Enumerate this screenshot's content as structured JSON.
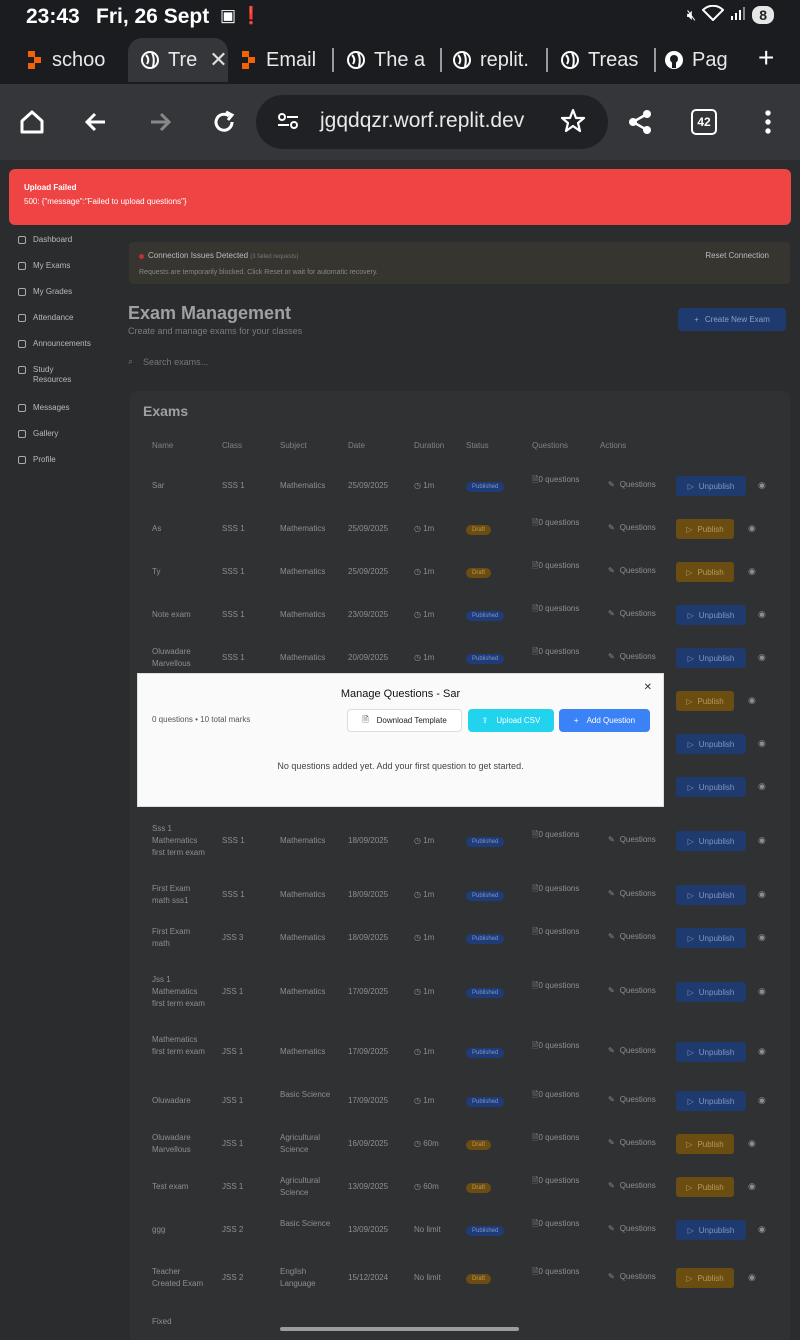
{
  "status": {
    "time": "23:43",
    "date": "Fri, 26 Sept",
    "battery": "8"
  },
  "tabs": [
    {
      "label": "schoo",
      "favicon": "replit-icon"
    },
    {
      "label": "Tre",
      "favicon": "globe-icon",
      "active": true
    },
    {
      "label": "Email",
      "favicon": "replit-icon"
    },
    {
      "label": "The a",
      "favicon": "globe-icon"
    },
    {
      "label": "replit.",
      "favicon": "globe-icon"
    },
    {
      "label": "Treas",
      "favicon": "globe-icon"
    },
    {
      "label": "Pag",
      "favicon": "github-icon"
    }
  ],
  "browser": {
    "url": "jgqdqzr.worf.replit.dev",
    "tab_count": "42"
  },
  "toast": {
    "title": "Upload Failed",
    "message": "500: {\"message\":\"Failed to upload questions\"}"
  },
  "sidebar": [
    {
      "label": "Dashboard"
    },
    {
      "label": "My Exams"
    },
    {
      "label": "My Grades"
    },
    {
      "label": "Attendance"
    },
    {
      "label": "Announcements"
    },
    {
      "label": "Study Resources"
    },
    {
      "label": "Messages"
    },
    {
      "label": "Gallery"
    },
    {
      "label": "Profile"
    }
  ],
  "connection": {
    "title": "Connection Issues Detected",
    "count": "(3 failed requests)",
    "subtitle": "Requests are temporarily blocked. Click Reset or wait for automatic recovery.",
    "reset": "Reset Connection"
  },
  "header": {
    "title": "Exam Management",
    "subtitle": "Create and manage exams for your classes",
    "create": "Create New Exam",
    "search_placeholder": "Search exams..."
  },
  "table": {
    "title": "Exams",
    "columns": [
      "Name",
      "Class",
      "Subject",
      "Date",
      "Duration",
      "Status",
      "Questions",
      "Actions"
    ],
    "questions_label": "Questions",
    "rows": [
      {
        "name": "Sar",
        "class": "SSS 1",
        "subject": "Mathematics",
        "date": "25/09/2025",
        "duration": "1m",
        "status": "Published",
        "questions": "0 questions",
        "action": "Unpublish"
      },
      {
        "name": "As",
        "class": "SSS 1",
        "subject": "Mathematics",
        "date": "25/09/2025",
        "duration": "1m",
        "status": "Draft",
        "questions": "0 questions",
        "action": "Publish"
      },
      {
        "name": "Ty",
        "class": "SSS 1",
        "subject": "Mathematics",
        "date": "25/09/2025",
        "duration": "1m",
        "status": "Draft",
        "questions": "0 questions",
        "action": "Publish"
      },
      {
        "name": "Note exam",
        "class": "SSS 1",
        "subject": "Mathematics",
        "date": "23/09/2025",
        "duration": "1m",
        "status": "Published",
        "questions": "0 questions",
        "action": "Unpublish"
      },
      {
        "name": "Oluwadare Marvellous",
        "class": "SSS 1",
        "subject": "Mathematics",
        "date": "20/09/2025",
        "duration": "1m",
        "status": "Published",
        "questions": "0 questions",
        "action": "Unpublish"
      },
      {
        "name": "",
        "class": "",
        "subject": "",
        "date": "",
        "duration": "",
        "status": "",
        "questions": "",
        "action": "Publish"
      },
      {
        "name": "",
        "class": "",
        "subject": "",
        "date": "",
        "duration": "",
        "status": "",
        "questions": "",
        "action": "Unpublish"
      },
      {
        "name": "",
        "class": "",
        "subject": "",
        "date": "",
        "duration": "",
        "status": "",
        "questions": "",
        "action": "Unpublish"
      },
      {
        "name": "Sss 1 Mathematics first term exam",
        "class": "SSS 1",
        "subject": "Mathematics",
        "date": "18/09/2025",
        "duration": "1m",
        "status": "Published",
        "questions": "0 questions",
        "action": "Unpublish"
      },
      {
        "name": "First Exam math sss1",
        "class": "SSS 1",
        "subject": "Mathematics",
        "date": "18/09/2025",
        "duration": "1m",
        "status": "Published",
        "questions": "0 questions",
        "action": "Unpublish"
      },
      {
        "name": "First Exam math",
        "class": "JSS 3",
        "subject": "Mathematics",
        "date": "18/09/2025",
        "duration": "1m",
        "status": "Published",
        "questions": "0 questions",
        "action": "Unpublish"
      },
      {
        "name": "Jss 1 Mathematics first term exam",
        "class": "JSS 1",
        "subject": "Mathematics",
        "date": "17/09/2025",
        "duration": "1m",
        "status": "Published",
        "questions": "0 questions",
        "action": "Unpublish"
      },
      {
        "name": "Mathematics first term exam",
        "class": "JSS 1",
        "subject": "Mathematics",
        "date": "17/09/2025",
        "duration": "1m",
        "status": "Published",
        "questions": "0 questions",
        "action": "Unpublish"
      },
      {
        "name": "Oluwadare",
        "class": "JSS 1",
        "subject": "Basic Science",
        "date": "17/09/2025",
        "duration": "1m",
        "status": "Published",
        "questions": "0 questions",
        "action": "Unpublish"
      },
      {
        "name": "Oluwadare Marvellous",
        "class": "JSS 1",
        "subject": "Agricultural Science",
        "date": "16/09/2025",
        "duration": "60m",
        "status": "Draft",
        "questions": "0 questions",
        "action": "Publish"
      },
      {
        "name": "Test exam",
        "class": "JSS 1",
        "subject": "Agricultural Science",
        "date": "13/09/2025",
        "duration": "60m",
        "status": "Draft",
        "questions": "0 questions",
        "action": "Publish"
      },
      {
        "name": "ggg",
        "class": "JSS 2",
        "subject": "Basic Science",
        "date": "13/09/2025",
        "duration": "No limit",
        "status": "Published",
        "questions": "0 questions",
        "action": "Unpublish"
      },
      {
        "name": "Teacher Created Exam",
        "class": "JSS 2",
        "subject": "English Language",
        "date": "15/12/2024",
        "duration": "No limit",
        "status": "Draft",
        "questions": "0 questions",
        "action": "Publish"
      },
      {
        "name": "Fixed",
        "class": "",
        "subject": "",
        "date": "",
        "duration": "",
        "status": "",
        "questions": "",
        "action": ""
      }
    ]
  },
  "modal": {
    "title": "Manage Questions - Sar",
    "summary": "0 questions • 10 total marks",
    "download": "Download Template",
    "upload": "Upload CSV",
    "add": "Add Question",
    "empty": "No questions added yet. Add your first question to get started."
  }
}
